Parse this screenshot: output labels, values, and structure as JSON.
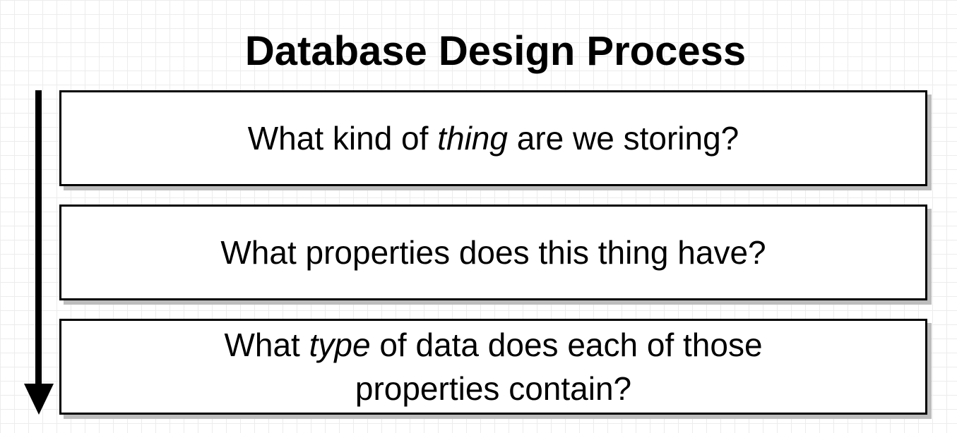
{
  "title": "Database Design Process",
  "steps": [
    {
      "before": "What kind of ",
      "emph": "thing",
      "after": " are we storing?"
    },
    {
      "text": "What properties does this thing have?"
    },
    {
      "line1_before": "What ",
      "line1_emph": "type",
      "line1_after": " of data does each of those",
      "line2": "properties contain?"
    }
  ]
}
